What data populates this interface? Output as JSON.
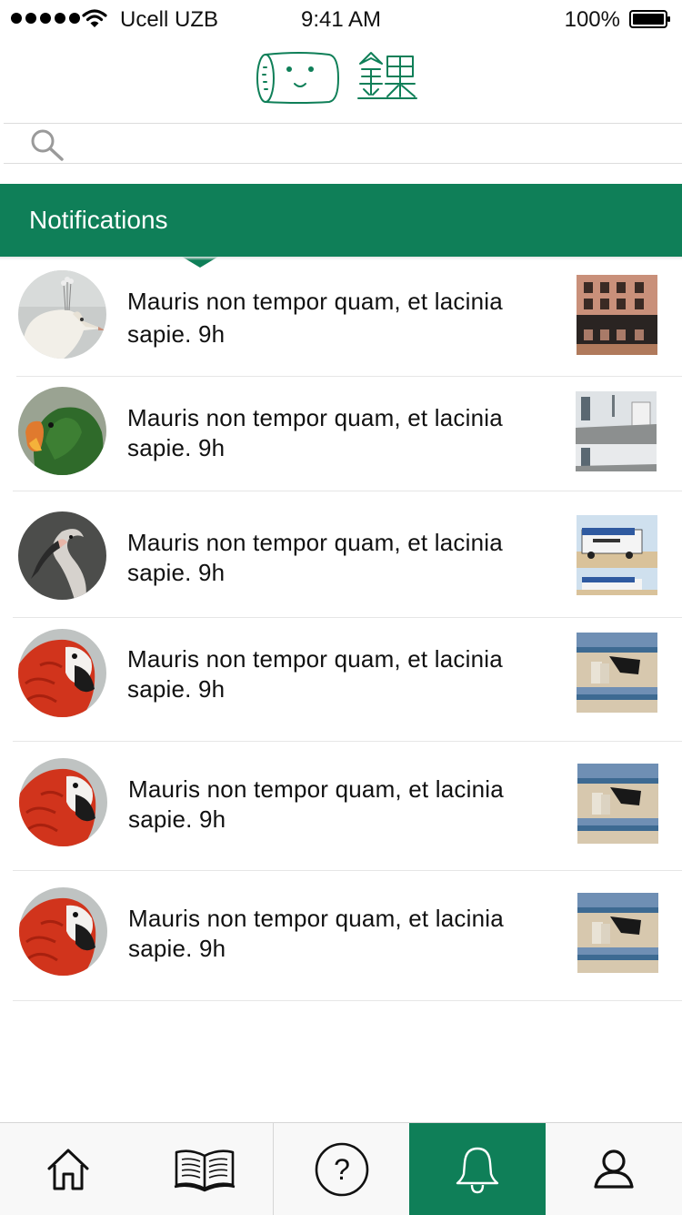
{
  "status_bar": {
    "carrier": "Ucell UZB",
    "time": "9:41 AM",
    "battery": "100%"
  },
  "search": {
    "placeholder": ""
  },
  "section": {
    "title": "Notifications"
  },
  "notifications": [
    {
      "text": "Mauris non tempor quam, et lacinia sapie. 9h",
      "avatar": "white-peacock",
      "thumb": "building"
    },
    {
      "text": "Mauris non tempor quam, et lacinia sapie. 9h",
      "avatar": "green-parrot",
      "thumb": "city-street"
    },
    {
      "text": "Mauris non tempor quam, et lacinia sapie. 9h",
      "avatar": "flamingo",
      "thumb": "camper-van"
    },
    {
      "text": "Mauris non tempor quam, et lacinia sapie. 9h",
      "avatar": "red-macaw",
      "thumb": "beach"
    },
    {
      "text": "Mauris non tempor quam, et lacinia sapie. 9h",
      "avatar": "red-macaw",
      "thumb": "beach"
    },
    {
      "text": "Mauris non tempor quam, et lacinia sapie. 9h",
      "avatar": "red-macaw",
      "thumb": "beach"
    }
  ],
  "tabs": [
    {
      "name": "home",
      "icon": "home-icon"
    },
    {
      "name": "library",
      "icon": "book-icon"
    },
    {
      "name": "help",
      "icon": "question-icon"
    },
    {
      "name": "notifications",
      "icon": "bell-icon",
      "active": true
    },
    {
      "name": "profile",
      "icon": "user-icon"
    }
  ],
  "colors": {
    "brand": "#0f7f58",
    "text": "#111111",
    "divider": "#e6e6e6"
  }
}
